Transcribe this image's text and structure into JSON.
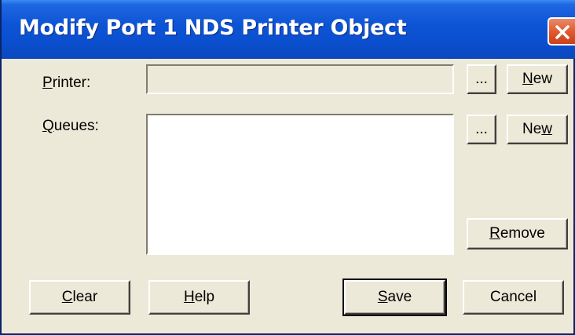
{
  "window": {
    "title": "Modify Port 1 NDS Printer Object"
  },
  "printer": {
    "label_key": "P",
    "label_rest": "rinter:",
    "value": "",
    "browse_label": "...",
    "new_label_key": "N",
    "new_label_rest": "ew"
  },
  "queues": {
    "label_key": "Q",
    "label_rest": "ueues:",
    "items": [],
    "browse_label": "...",
    "new_label_pre": "Ne",
    "new_label_key": "w",
    "remove_label_key": "R",
    "remove_label_rest": "emove"
  },
  "buttons": {
    "clear_key": "C",
    "clear_rest": "lear",
    "help_key": "H",
    "help_rest": "elp",
    "save_key": "S",
    "save_rest": "ave",
    "cancel": "Cancel"
  }
}
